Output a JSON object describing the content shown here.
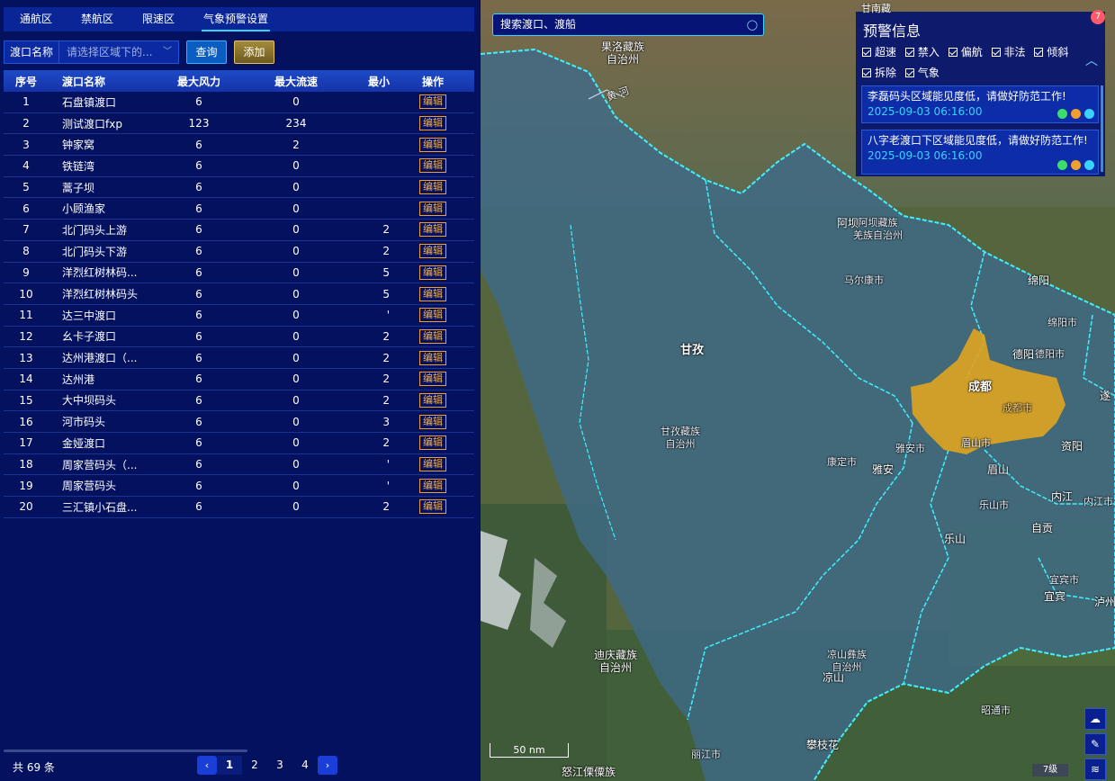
{
  "tabs": [
    {
      "label": "通航区"
    },
    {
      "label": "禁航区"
    },
    {
      "label": "限速区"
    },
    {
      "label": "气象预警设置"
    }
  ],
  "filter": {
    "label": "渡口名称",
    "placeholder": "请选择区域下的...",
    "query_label": "查询",
    "add_label": "添加"
  },
  "table": {
    "headers": [
      "序号",
      "渡口名称",
      "最大风力",
      "最大流速",
      "最小",
      "操作"
    ],
    "edit_label": "编辑",
    "rows": [
      {
        "no": "1",
        "name": "石盘镇渡口",
        "wind": "6",
        "flow": "0",
        "min": ""
      },
      {
        "no": "2",
        "name": "测试渡口fxp",
        "wind": "123",
        "flow": "234",
        "min": ""
      },
      {
        "no": "3",
        "name": "钟家窝",
        "wind": "6",
        "flow": "2",
        "min": ""
      },
      {
        "no": "4",
        "name": "铁链湾",
        "wind": "6",
        "flow": "0",
        "min": ""
      },
      {
        "no": "5",
        "name": "蒿子坝",
        "wind": "6",
        "flow": "0",
        "min": ""
      },
      {
        "no": "6",
        "name": "小顾渔家",
        "wind": "6",
        "flow": "0",
        "min": ""
      },
      {
        "no": "7",
        "name": "北门码头上游",
        "wind": "6",
        "flow": "0",
        "min": "2"
      },
      {
        "no": "8",
        "name": "北门码头下游",
        "wind": "6",
        "flow": "0",
        "min": "2"
      },
      {
        "no": "9",
        "name": "洋烈红树林码...",
        "wind": "6",
        "flow": "0",
        "min": "5"
      },
      {
        "no": "10",
        "name": "洋烈红树林码头",
        "wind": "6",
        "flow": "0",
        "min": "5"
      },
      {
        "no": "11",
        "name": "达三中渡口",
        "wind": "6",
        "flow": "0",
        "min": "'"
      },
      {
        "no": "12",
        "name": "幺卡子渡口",
        "wind": "6",
        "flow": "0",
        "min": "2"
      },
      {
        "no": "13",
        "name": "达州港渡口（...",
        "wind": "6",
        "flow": "0",
        "min": "2"
      },
      {
        "no": "14",
        "name": "达州港",
        "wind": "6",
        "flow": "0",
        "min": "2"
      },
      {
        "no": "15",
        "name": "大中坝码头",
        "wind": "6",
        "flow": "0",
        "min": "2"
      },
      {
        "no": "16",
        "name": "河市码头",
        "wind": "6",
        "flow": "0",
        "min": "3"
      },
      {
        "no": "17",
        "name": "金娅渡口",
        "wind": "6",
        "flow": "0",
        "min": "2"
      },
      {
        "no": "18",
        "name": "周家营码头（...",
        "wind": "6",
        "flow": "0",
        "min": "'"
      },
      {
        "no": "19",
        "name": "周家营码头",
        "wind": "6",
        "flow": "0",
        "min": "'"
      },
      {
        "no": "20",
        "name": "三汇镇小石盘...",
        "wind": "6",
        "flow": "0",
        "min": "2"
      }
    ]
  },
  "footer": {
    "total": "共 69 条",
    "pages": [
      "1",
      "2",
      "3",
      "4"
    ],
    "current_page": "1",
    "prev": "‹",
    "next": "›"
  },
  "map": {
    "search_placeholder": "搜索渡口、渡船",
    "scale_label": "50 nm",
    "zoom_label": "7级",
    "labels": {
      "guoluo": "果洛藏族\n自治州",
      "gannan": "甘南藏族",
      "aba_city": "阿坝",
      "aba_pref": "阿坝藏族\n羌族自治州",
      "maerkang": "马尔康市",
      "mianyang": "绵阳",
      "mianyang_city": "绵阳市",
      "deyang": "德阳",
      "deyang_city": "德阳市",
      "ganzi": "甘孜",
      "ganzi_pref": "甘孜藏族\n自治州",
      "chengdu": "成都",
      "chengdu_city": "成都市",
      "suining": "遂",
      "yaan_city": "雅安市",
      "yaan": "雅安",
      "kangding": "康定市",
      "meishan_city": "眉山市",
      "meishan": "眉山",
      "ziyang": "资阳",
      "ziyang_city": "资阳市",
      "neijiang": "内江",
      "neijiang_city": "内江市",
      "leshan_city": "乐山市",
      "leshan": "乐山",
      "zigong": "自贡",
      "yibin_city": "宜宾市",
      "yibin": "宜宾",
      "luzhou": "泸州",
      "diqing": "迪庆藏族\n自治州",
      "liangshan": "凉山彝族\n自治州",
      "liangshan_short": "凉山",
      "panzhihua": "攀枝花",
      "zhaotong": "昭通市",
      "lijiang": "丽江市",
      "nujiang": "怒江傈僳族",
      "river": "黄 河"
    }
  },
  "warning": {
    "top_text": "甘南藏",
    "title": "预警信息",
    "badge": "7",
    "filters": [
      "超速",
      "禁入",
      "偏航",
      "非法",
      "倾斜",
      "拆除",
      "气象"
    ],
    "items": [
      {
        "message": "李磊码头区域能见度低，请做好防范工作!",
        "time": "2025-09-03 06:16:00"
      },
      {
        "message": "八字老渡口下区域能见度低，请做好防范工作!",
        "time": "2025-09-03 06:16:00"
      }
    ]
  },
  "colors": {
    "panel_bg": "#04115e",
    "accent_cyan": "#37d4ff",
    "edit_orange": "#f4b04a",
    "chengdu_fill": "#e0a520"
  }
}
